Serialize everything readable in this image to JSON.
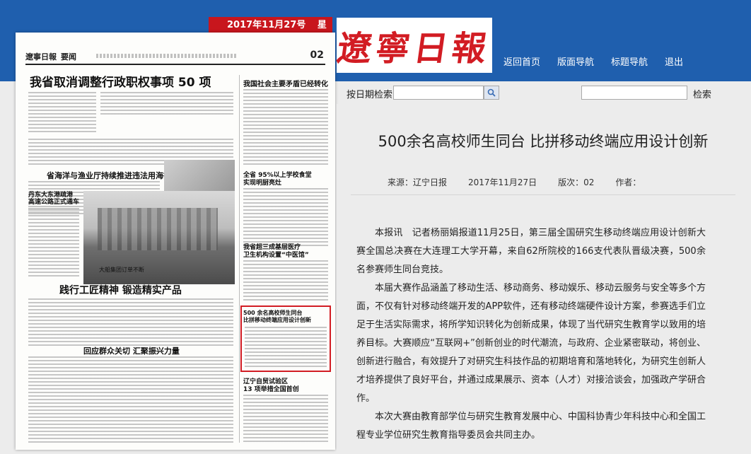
{
  "header": {
    "date": "2017年11月27号",
    "weekday": "星期一",
    "logo_text": "遼寧日報",
    "nav": [
      "返回首页",
      "版面导航",
      "标题导航",
      "退出"
    ]
  },
  "search": {
    "date_label": "按日期检索",
    "date_value": "",
    "keyword_value": "",
    "keyword_button": "检索"
  },
  "paper": {
    "logo": "遼寧日報",
    "section": "要闻",
    "page_number": "02",
    "headlines": {
      "main": "我省取消调整行政职权事项 50 项",
      "h2": "省海洋与渔业厅持续推进违法用海行为整改",
      "h3": "践行工匠精神  锻造精实产品",
      "h4": "回应群众关切  汇聚振兴力量",
      "side1": "我国社会主要矛盾已经转化",
      "side2a": "全省 95%以上学校食堂",
      "side2b": "实现明厨亮灶",
      "side3a": "我省超三成基层医疗",
      "side3b": "卫生机构设置“中医馆”",
      "side4a": "500 余名高校师生同台",
      "side4b": "比拼移动终端应用设计创新",
      "side5a": "辽宁自贸试验区",
      "side5b": "13 项举措全国首创",
      "left1a": "丹东大东港疏港",
      "left1b": "高速公路正式通车",
      "photo_caption": "大船集团订单不断"
    }
  },
  "article": {
    "title": "500余名高校师生同台 比拼移动终端应用设计创新",
    "source_label": "来源：辽宁日报",
    "date": "2017年11月27日",
    "edition": "版次：02",
    "author_label": "作者：",
    "paragraphs": [
      "本报讯　记者杨丽娟报道11月25日，第三届全国研究生移动终端应用设计创新大赛全国总决赛在大连理工大学开幕，来自62所院校的166支代表队晋级决赛，500余名参赛师生同台竞技。",
      "本届大赛作品涵盖了移动生活、移动商务、移动娱乐、移动云服务与安全等多个方面，不仅有针对移动终端开发的APP软件，还有移动终端硬件设计方案，参赛选手们立足于生活实际需求，将所学知识转化为创新成果，体现了当代研究生教育学以致用的培养目标。大赛顺应“互联网+”创新创业的时代潮流，与政府、企业紧密联动，将创业、创新进行融合，有效提升了对研究生科技作品的初期培育和落地转化，为研究生创新人才培养提供了良好平台，并通过成果展示、资本（人才）对接洽谈会，加强政产学研合作。",
      "本次大赛由教育部学位与研究生教育发展中心、中国科协青少年科技中心和全国工程专业学位研究生教育指导委员会共同主办。"
    ]
  }
}
